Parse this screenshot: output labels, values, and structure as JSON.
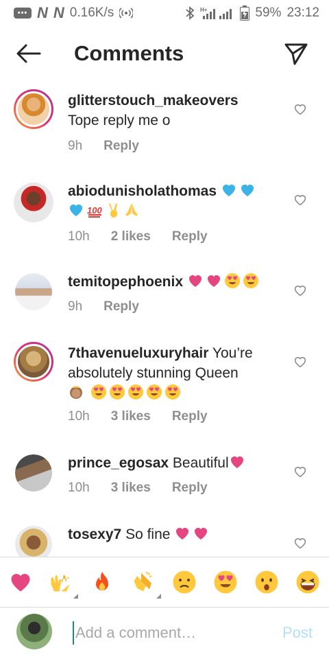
{
  "status_bar": {
    "speed": "0.16K/s",
    "battery": "59%",
    "time": "23:12"
  },
  "header": {
    "title": "Comments"
  },
  "comments": [
    {
      "username": "glitterstouch_makeovers",
      "text": "Tope reply me o",
      "emojis": [],
      "time": "9h",
      "likes": "",
      "reply_label": "Reply"
    },
    {
      "username": "abiodunisholathomas",
      "text": "",
      "emojis": [
        "blue-heart",
        "blue-heart",
        "blue-heart",
        "hundred-points",
        "victory-hand",
        "folded-hands"
      ],
      "time": "10h",
      "likes": "2 likes",
      "reply_label": "Reply"
    },
    {
      "username": "temitopephoenix",
      "text": "",
      "emojis": [
        "pink-heart",
        "pink-heart",
        "heart-eyes",
        "heart-eyes"
      ],
      "time": "9h",
      "likes": "",
      "reply_label": "Reply"
    },
    {
      "username": "7thavenueluxuryhair",
      "text": "You’re absolutely stunning Queen",
      "emojis": [
        "princess",
        "heart-eyes",
        "heart-eyes",
        "heart-eyes",
        "heart-eyes",
        "heart-eyes"
      ],
      "time": "10h",
      "likes": "3 likes",
      "reply_label": "Reply"
    },
    {
      "username": "prince_egosax",
      "text": "Beautiful",
      "emojis": [
        "pink-heart"
      ],
      "time": "10h",
      "likes": "3 likes",
      "reply_label": "Reply"
    },
    {
      "username": "tosexy7",
      "text": "So fine",
      "emojis": [
        "pink-heart",
        "pink-heart"
      ],
      "time": "",
      "likes": "",
      "reply_label": ""
    }
  ],
  "reactions": [
    "pink-heart",
    "raising-hands",
    "fire",
    "clapping-hands",
    "sad-face",
    "heart-eyes",
    "surprised-face",
    "grinning-squint"
  ],
  "comment_input": {
    "placeholder": "Add a comment…",
    "post_label": "Post"
  },
  "colors": {
    "heart_pink": "#e5467f",
    "blue_heart": "#3bb3e6",
    "emoji_yellow": "#ffc83d",
    "post_disabled": "#b2dffc",
    "meta_grey": "#8e8e8e"
  }
}
